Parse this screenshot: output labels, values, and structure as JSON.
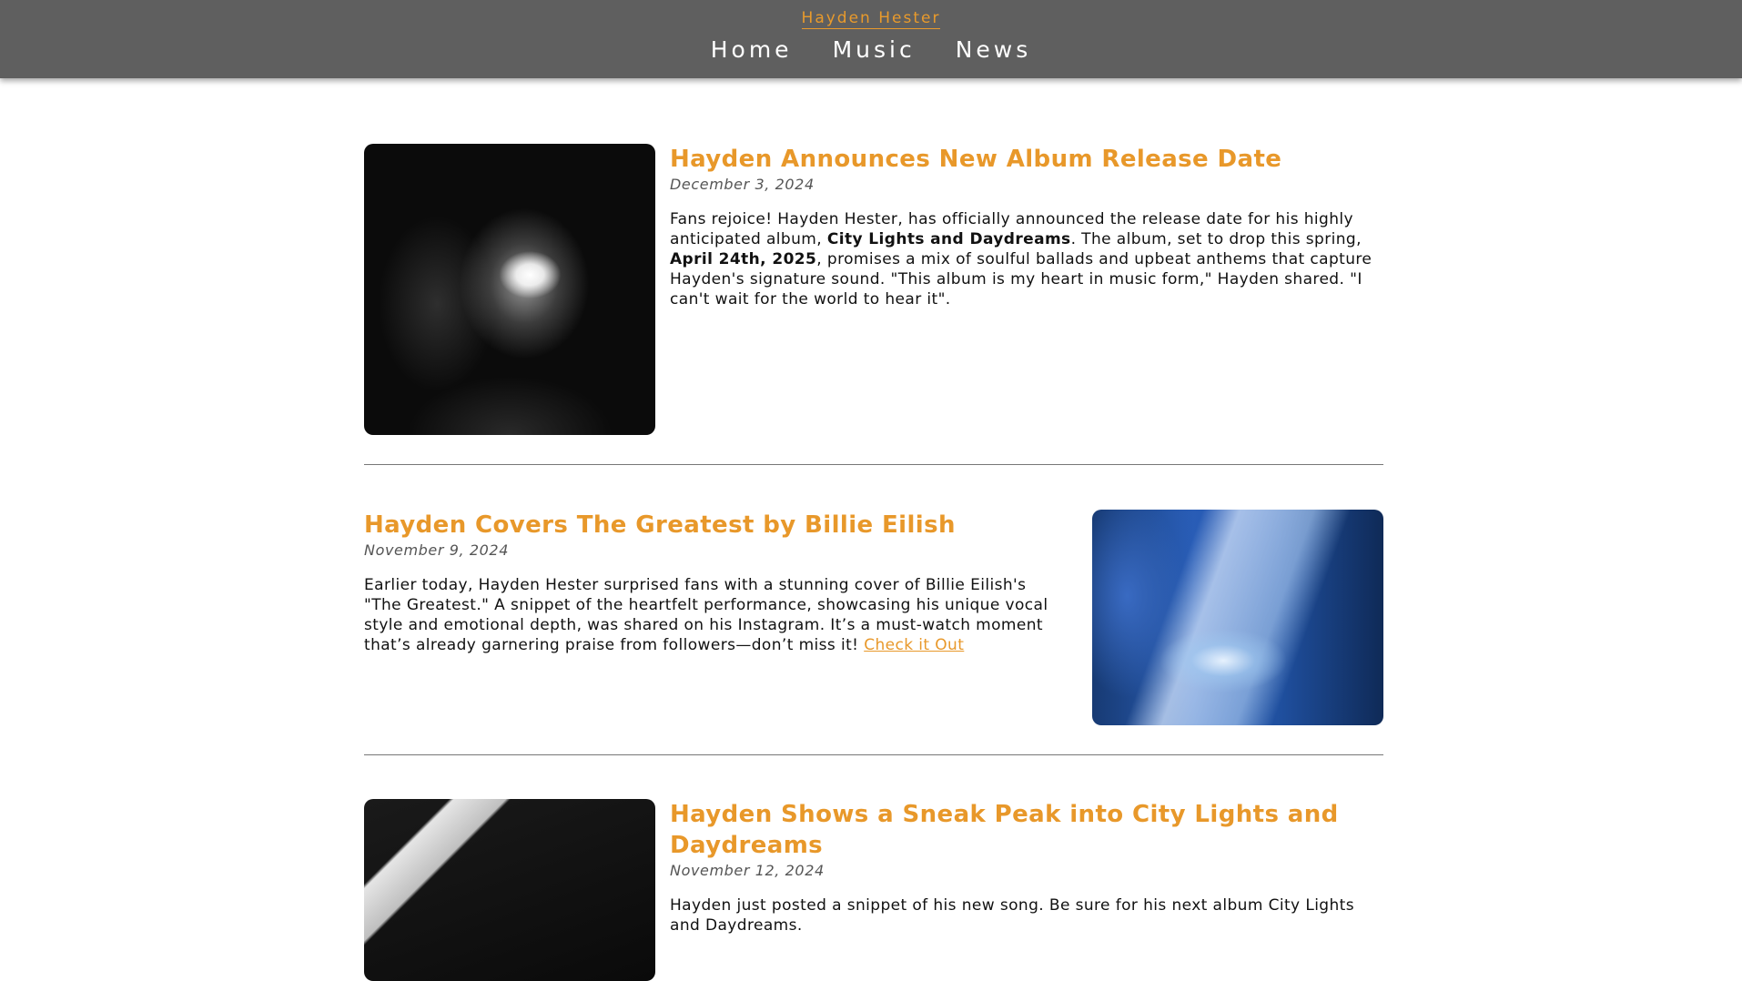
{
  "header": {
    "brand": "Hayden Hester",
    "nav": [
      "Home",
      "Music",
      "News"
    ]
  },
  "articles": [
    {
      "title": "Hayden Announces New Album Release Date",
      "date": "December 3, 2024",
      "body": [
        "Fans rejoice! Hayden Hester, has officially announced the release date for his highly anticipated album, ",
        "City Lights and Daydreams",
        ". The album, set to drop this spring, ",
        "April 24th, 2025",
        ", promises a mix of soulful ballads and upbeat anthems that capture Hayden's signature sound. \"This album is my heart in music form,\" Hayden shared. \"I can't wait for the world to hear it\"."
      ]
    },
    {
      "title": "Hayden Covers The Greatest by Billie Eilish",
      "date": "November 9, 2024",
      "body": [
        "Earlier today, Hayden Hester surprised fans with a stunning cover of Billie Eilish's \"The Greatest.\" A snippet of the heartfelt performance, showcasing his unique vocal style and emotional depth, was shared on his Instagram. It’s a must-watch moment that’s already garnering praise from followers—don’t miss it! "
      ],
      "link_label": "Check it Out"
    },
    {
      "title": "Hayden Shows a Sneak Peak into City Lights and Daydreams",
      "date": "November 12, 2024",
      "body": [
        "Hayden just posted a snippet of his new song. Be sure for his next album City Lights and Daydreams."
      ]
    }
  ],
  "colors": {
    "accent": "#e8982a",
    "header_bg": "#5f5f5f"
  }
}
